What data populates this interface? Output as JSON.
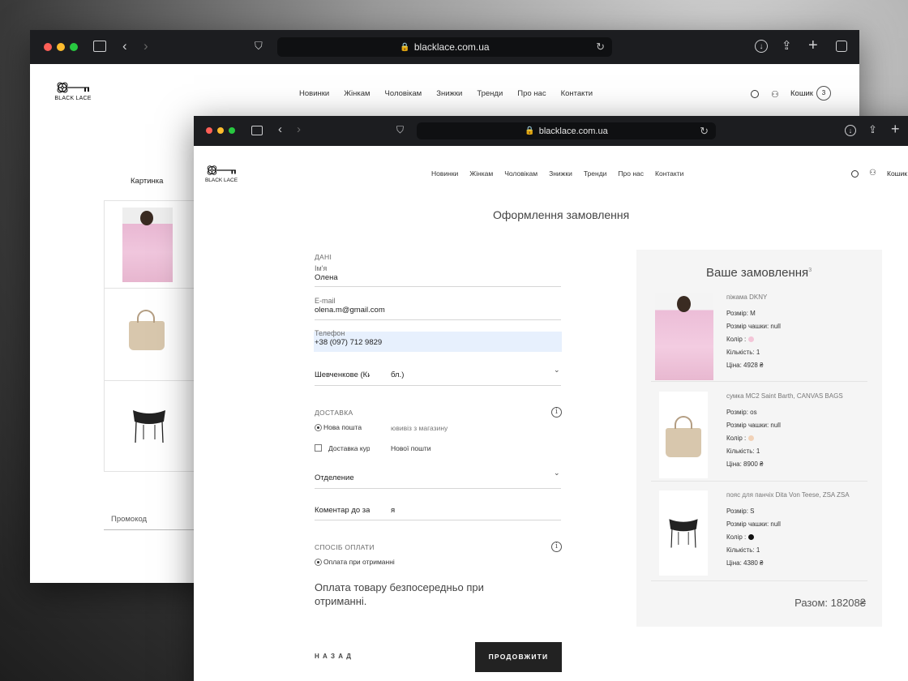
{
  "browser": {
    "url": "blacklace.com.ua"
  },
  "brand": {
    "name": "BLACK LACE"
  },
  "nav": [
    "Новинки",
    "Жінкам",
    "Чоловікам",
    "Знижки",
    "Тренди",
    "Про нас",
    "Контакти"
  ],
  "cart": {
    "label": "Кошик",
    "count": "3"
  },
  "back_page": {
    "column_header": "Картинка",
    "promo_placeholder": "Промокод"
  },
  "checkout": {
    "title": "Оформлення замовлення",
    "data_section": "ДАНІ",
    "name_label": "Ім'я",
    "name_value": "Олена",
    "email_label": "E-mail",
    "email_value": "olena.m@gmail.com",
    "phone_label": "Телефон",
    "phone_value": "+38 (097) 712 9829",
    "region_left": "Шевченкове (Киї",
    "region_right": "бл.)",
    "delivery_section": "ДОСТАВКА",
    "delivery_opt1": "Нова пошта",
    "delivery_opt1_hint": "ювивіз з магазину",
    "delivery_opt2": "Доставка кур",
    "delivery_opt2_hint": "Нової пошти",
    "branch_label": "Отделение",
    "comment_label": "Коментар до зам",
    "comment_suffix": "я",
    "payment_section": "СПОСІБ ОПЛАТИ",
    "payment_opt": "Оплата при отриманні",
    "payment_note": "Оплата товару безпосередньо при отриманні.",
    "back_label": "Н А З А Д",
    "continue_label": "ПРОДОВЖИТИ"
  },
  "order": {
    "title": "Ваше замовлення",
    "count_sup": "3",
    "items": [
      {
        "name": "піжама DKNY",
        "size": "Розмір: M",
        "cup": "Розмір чашки: null",
        "color": "Колір :",
        "color_hex": "#f3c6d8",
        "qty": "Кількість: 1",
        "price": "Ціна: 4928 ₴"
      },
      {
        "name": "сумка MC2 Saint Barth, CANVAS BAGS",
        "size": "Розмір: os",
        "cup": "Розмір чашки: null",
        "color": "Колір :",
        "color_hex": "#f1d2b8",
        "qty": "Кількість: 1",
        "price": "Ціна: 8900 ₴"
      },
      {
        "name": "пояс для панчіх Dita Von Teese, ZSA ZSA",
        "size": "Розмір: S",
        "cup": "Розмір чашки: null",
        "color": "Колір :",
        "color_hex": "#111111",
        "qty": "Кількість: 1",
        "price": "Ціна: 4380 ₴"
      }
    ],
    "total": "Разом: 18208₴"
  }
}
